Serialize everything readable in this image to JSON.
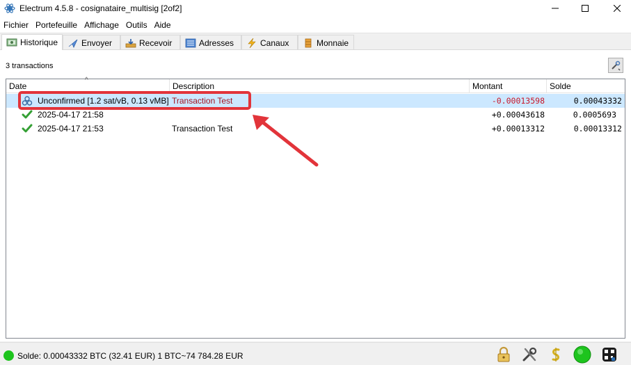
{
  "window": {
    "title": "Electrum 4.5.8  -  cosignataire_multisig  [2of2]",
    "minimize_glyph": "—",
    "maximize_glyph": "☐",
    "close_glyph": "✕"
  },
  "menu": [
    "Fichier",
    "Portefeuille",
    "Affichage",
    "Outils",
    "Aide"
  ],
  "tabs": [
    {
      "label": "Historique",
      "icon": "history-icon",
      "active": true
    },
    {
      "label": "Envoyer",
      "icon": "send-icon",
      "active": false
    },
    {
      "label": "Recevoir",
      "icon": "receive-icon",
      "active": false
    },
    {
      "label": "Adresses",
      "icon": "addresses-icon",
      "active": false
    },
    {
      "label": "Canaux",
      "icon": "lightning-icon",
      "active": false
    },
    {
      "label": "Monnaie",
      "icon": "coins-icon",
      "active": false
    }
  ],
  "history": {
    "count_label": "3 transactions",
    "sort_indicator": "^",
    "columns": {
      "date": "Date",
      "description": "Description",
      "amount": "Montant",
      "balance": "Solde"
    },
    "rows": [
      {
        "status": "unconfirmed-icon",
        "date": "Unconfirmed [1.2 sat/vB, 0.13 vMB]",
        "description": "Transaction Test",
        "amount": "-0.00013598",
        "balance": "0.00043332",
        "selected": true
      },
      {
        "status": "confirmed-check-icon",
        "date": "2025-04-17 21:58",
        "description": "",
        "amount": "+0.00043618",
        "balance": "0.0005693",
        "selected": false
      },
      {
        "status": "confirmed-check-icon",
        "date": "2025-04-17 21:53",
        "description": "Transaction Test",
        "amount": "+0.00013312",
        "balance": "0.00013312",
        "selected": false
      }
    ]
  },
  "statusbar": {
    "text": "Solde: 0.00043332 BTC (32.41 EUR)  1 BTC~74 784.28 EUR"
  },
  "colors": {
    "selection": "#cce8ff",
    "negative_amount": "#c8182a",
    "annotation": "#e2343a",
    "connected": "#1ec41e"
  }
}
